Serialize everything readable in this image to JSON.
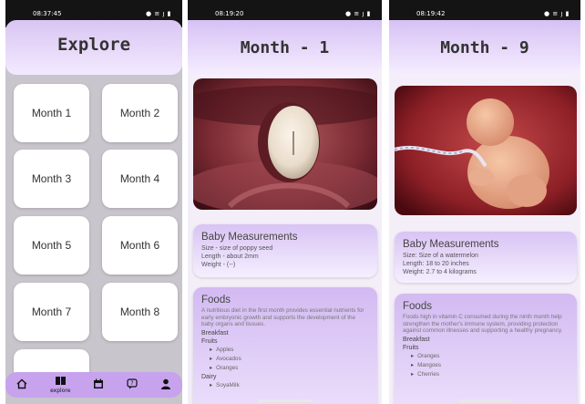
{
  "screens": [
    {
      "status_time": "08:37:45",
      "status_icons": "● ≡ ȷ ▮",
      "title": "Explore",
      "months": [
        "Month 1",
        "Month 2",
        "Month 3",
        "Month 4",
        "Month 5",
        "Month 6",
        "Month 7",
        "Month 8"
      ],
      "nav": {
        "home_icon": "home-icon",
        "explore_icon": "book-icon",
        "explore_label": "explore",
        "calendar_icon": "calendar-icon",
        "chat_icon": "chat-icon",
        "profile_icon": "person-icon"
      }
    },
    {
      "status_time": "08:19:20",
      "status_icons": "● ≡ ȷ ▮",
      "title": "Month - 1",
      "measurements": {
        "heading": "Baby Measurements",
        "size": "Size - size of poppy seed",
        "length": "Length - about 2mm",
        "weight": "Weight - (--)"
      },
      "foods": {
        "heading": "Foods",
        "intro": "A nutritious diet in the first month provides essential nutrients for early embryonic growth and supports the development of the baby organs and tissues.",
        "breakfast": "Breakfast",
        "fruits": "Fruits",
        "fruit_items": [
          "Apples",
          "Avocados",
          "Oranges"
        ],
        "dairy": "Dairy",
        "dairy_items": [
          "SoyaMilk"
        ]
      }
    },
    {
      "status_time": "08:19:42",
      "status_icons": "● ≡ ȷ ▮",
      "title": "Month - 9",
      "measurements": {
        "heading": "Baby Measurements",
        "size": "Size: Size of a watermelon",
        "length": "Length: 18 to 20 inches",
        "weight": "Weight: 2.7 to 4 kilograms"
      },
      "foods": {
        "heading": "Foods",
        "intro": "Foods high in vitamin C consumed during the ninth month help strengthen the mother's immune system, providing protection against common illnesses and supporting a healthy pregnancy.",
        "breakfast": "Breakfast",
        "fruits": "Fruits",
        "fruit_items": [
          "Oranges",
          "Mangoes",
          "Cherries"
        ]
      }
    }
  ],
  "colors": {
    "accent": "#c7a3ee",
    "header_gradient_top": "#d7c1f5",
    "card_white": "#ffffff"
  }
}
